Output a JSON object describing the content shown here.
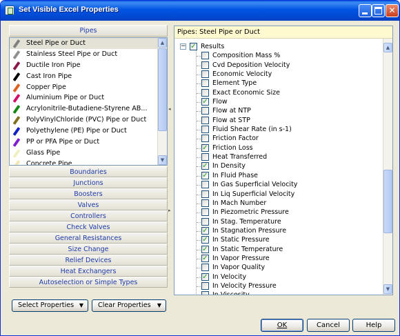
{
  "window": {
    "title": "Set Visible Excel Properties"
  },
  "left": {
    "pipes_header": "Pipes",
    "pipes": [
      {
        "label": "Steel Pipe or Duct",
        "color": "#808080",
        "selected": true
      },
      {
        "label": "Stainless Steel Pipe or Duct",
        "color": "#909090"
      },
      {
        "label": "Ductile Iron Pipe",
        "color": "#8b1a4a"
      },
      {
        "label": "Cast Iron Pipe",
        "color": "#000000"
      },
      {
        "label": "Copper Pipe",
        "color": "#e06020"
      },
      {
        "label": "Aluminium Pipe or Duct",
        "color": "#d0106a"
      },
      {
        "label": "Acrylonitrile-Butadiene-Styrene AB...",
        "color": "#108a10"
      },
      {
        "label": "PolyVinylChloride (PVC) Pipe or Duct",
        "color": "#807020"
      },
      {
        "label": "Polyethylene (PE) Pipe or Duct",
        "color": "#1020c0"
      },
      {
        "label": "PP or PFA Pipe or Duct",
        "color": "#8020d0"
      },
      {
        "label": "Glass Pipe",
        "color": "#f0f0c0"
      },
      {
        "label": "Concrete Pipe",
        "color": "#f0e8b0"
      }
    ],
    "sections": [
      "Boundaries",
      "Junctions",
      "Boosters",
      "Valves",
      "Controllers",
      "Check Valves",
      "General Resistances",
      "Size Change",
      "Relief Devices",
      "Heat Exchangers",
      "Autoselection or Simple Types"
    ],
    "select_properties": "Select Properties",
    "clear_properties": "Clear Properties"
  },
  "right": {
    "header": "Pipes: Steel Pipe or Duct",
    "root": {
      "label": "Results",
      "checked": true,
      "expander": "−"
    },
    "items": [
      {
        "label": "Composition Mass %",
        "checked": false
      },
      {
        "label": "Cvd Deposition Velocity",
        "checked": false
      },
      {
        "label": "Economic Velocity",
        "checked": false
      },
      {
        "label": "Element Type",
        "checked": false
      },
      {
        "label": "Exact Economic Size",
        "checked": false
      },
      {
        "label": "Flow",
        "checked": true
      },
      {
        "label": "Flow at NTP",
        "checked": false
      },
      {
        "label": "Flow at STP",
        "checked": false
      },
      {
        "label": "Fluid Shear Rate (in s-1)",
        "checked": false
      },
      {
        "label": "Friction Factor",
        "checked": false
      },
      {
        "label": "Friction Loss",
        "checked": true
      },
      {
        "label": "Heat Transferred",
        "checked": false
      },
      {
        "label": "In Density",
        "checked": true
      },
      {
        "label": "In Fluid Phase",
        "checked": true
      },
      {
        "label": "In Gas Superficial Velocity",
        "checked": false
      },
      {
        "label": "In Liq Superficial Velocity",
        "checked": false
      },
      {
        "label": "In Mach Number",
        "checked": false
      },
      {
        "label": "In Piezometric Pressure",
        "checked": false
      },
      {
        "label": "In Stag. Temperature",
        "checked": false
      },
      {
        "label": "In Stagnation Pressure",
        "checked": true
      },
      {
        "label": "In Static Pressure",
        "checked": true
      },
      {
        "label": "In Static Temperature",
        "checked": true
      },
      {
        "label": "In Vapor Pressure",
        "checked": true
      },
      {
        "label": "In Vapor Quality",
        "checked": false
      },
      {
        "label": "In Velocity",
        "checked": true
      },
      {
        "label": "In Velocity Pressure",
        "checked": false
      },
      {
        "label": "In Viscosity",
        "checked": false
      }
    ]
  },
  "buttons": {
    "ok": "OK",
    "cancel": "Cancel",
    "help": "Help"
  },
  "glyphs": {
    "up": "▲",
    "down": "▼",
    "dropdown": "▼",
    "check": "✓",
    "left": "◂",
    "right": "▸",
    "close": "✕"
  }
}
